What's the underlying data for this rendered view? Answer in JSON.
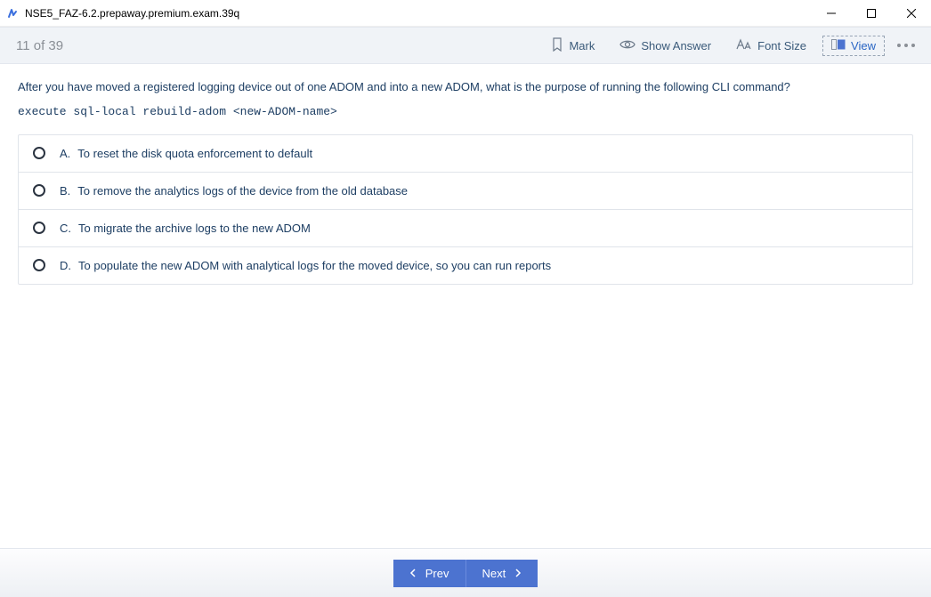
{
  "window": {
    "title": "NSE5_FAZ-6.2.prepaway.premium.exam.39q"
  },
  "toolbar": {
    "counter": "11 of 39",
    "mark": "Mark",
    "show_answer": "Show Answer",
    "font_size": "Font Size",
    "view": "View"
  },
  "question": {
    "text": "After you have moved a registered logging device out of one ADOM and into a new ADOM, what is the purpose of running the following CLI command?",
    "code": "execute sql-local rebuild-adom <new-ADOM-name>"
  },
  "options": [
    {
      "letter": "A.",
      "text": "To reset the disk quota enforcement to default"
    },
    {
      "letter": "B.",
      "text": "To remove the analytics logs of the device from the old database"
    },
    {
      "letter": "C.",
      "text": "To migrate the archive logs to the new ADOM"
    },
    {
      "letter": "D.",
      "text": "To populate the new ADOM with analytical logs for the moved device, so you can run reports"
    }
  ],
  "footer": {
    "prev": "Prev",
    "next": "Next"
  }
}
